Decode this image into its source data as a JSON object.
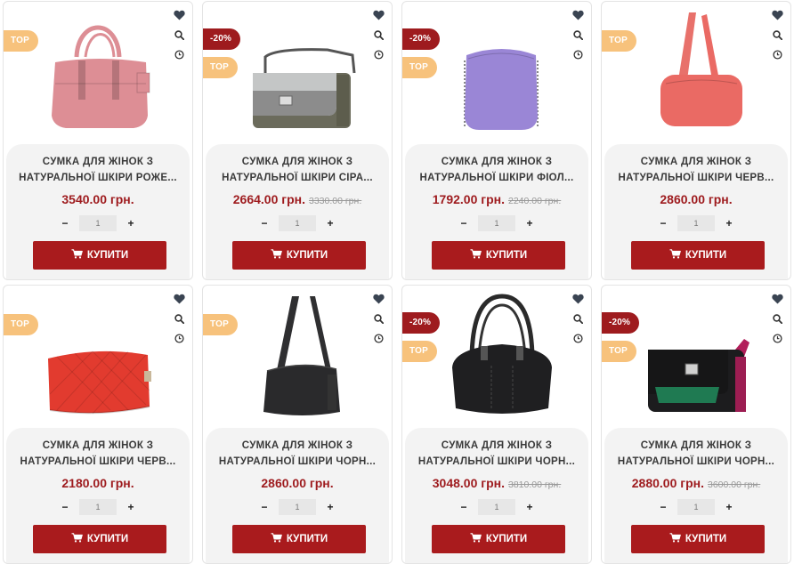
{
  "currency": "грн.",
  "labels": {
    "buy": "КУПИТИ",
    "minus": "−",
    "plus": "+",
    "top_badge": "TOP"
  },
  "icons": {
    "wishlist": "heart-icon",
    "quick_view": "search-icon",
    "compare": "clock-icon",
    "cart": "cart-icon"
  },
  "colors": {
    "accent": "#a91b1d",
    "top_badge": "#f7c27c",
    "discount_badge": "#9e1b1e"
  },
  "products": [
    {
      "title1": "СУМКА ДЛЯ ЖІНОК З",
      "title2": "НАТУРАЛЬНОЇ ШКІРИ РОЖЕ...",
      "price": "3540.00 грн.",
      "old_price": "",
      "discount": "",
      "top": "TOP",
      "qty": "1",
      "bag_color": "#dd8e95",
      "bag_type": "tote"
    },
    {
      "title1": "СУМКА ДЛЯ ЖІНОК З",
      "title2": "НАТУРАЛЬНОЇ ШКІРИ СІРА...",
      "price": "2664.00 грн.",
      "old_price": "3330.00 грн.",
      "discount": "-20%",
      "top": "TOP",
      "qty": "1",
      "bag_color": "#c4c6c6",
      "bag_type": "flap"
    },
    {
      "title1": "СУМКА ДЛЯ ЖІНОК З",
      "title2": "НАТУРАЛЬНОЇ ШКІРИ ФІОЛ...",
      "price": "1792.00 грн.",
      "old_price": "2240.00 грн.",
      "discount": "-20%",
      "top": "TOP",
      "qty": "1",
      "bag_color": "#9a86d6",
      "bag_type": "box"
    },
    {
      "title1": "СУМКА ДЛЯ ЖІНОК З",
      "title2": "НАТУРАЛЬНОЇ ШКІРИ ЧЕРВ...",
      "price": "2860.00 грн.",
      "old_price": "",
      "discount": "",
      "top": "TOP",
      "qty": "1",
      "bag_color": "#ea6a64",
      "bag_type": "shoulder"
    },
    {
      "title1": "СУМКА ДЛЯ ЖІНОК З",
      "title2": "НАТУРАЛЬНОЇ ШКІРИ ЧЕРВ...",
      "price": "2180.00 грн.",
      "old_price": "",
      "discount": "",
      "top": "TOP",
      "qty": "1",
      "bag_color": "#e23b2f",
      "bag_type": "quilted"
    },
    {
      "title1": "СУМКА ДЛЯ ЖІНОК З",
      "title2": "НАТУРАЛЬНОЇ ШКІРИ ЧОРН...",
      "price": "2860.00 грн.",
      "old_price": "",
      "discount": "",
      "top": "TOP",
      "qty": "1",
      "bag_color": "#2a2a2c",
      "bag_type": "shoulder2"
    },
    {
      "title1": "СУМКА ДЛЯ ЖІНОК З",
      "title2": "НАТУРАЛЬНОЇ ШКІРИ ЧОРН...",
      "price": "3048.00 грн.",
      "old_price": "3810.00 грн.",
      "discount": "-20%",
      "top": "TOP",
      "qty": "1",
      "bag_color": "#1f1f21",
      "bag_type": "bowling"
    },
    {
      "title1": "СУМКА ДЛЯ ЖІНОК З",
      "title2": "НАТУРАЛЬНОЇ ШКІРИ ЧОРН...",
      "price": "2880.00 грн.",
      "old_price": "3600.00 грн.",
      "discount": "-20%",
      "top": "TOP",
      "qty": "1",
      "bag_color": "#1c1c1e",
      "bag_type": "flap2"
    }
  ]
}
